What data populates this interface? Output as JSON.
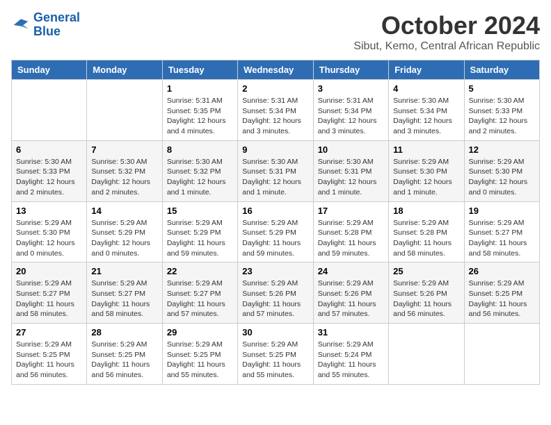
{
  "logo": {
    "line1": "General",
    "line2": "Blue"
  },
  "title": "October 2024",
  "subtitle": "Sibut, Kemo, Central African Republic",
  "weekdays": [
    "Sunday",
    "Monday",
    "Tuesday",
    "Wednesday",
    "Thursday",
    "Friday",
    "Saturday"
  ],
  "weeks": [
    [
      {
        "day": null,
        "detail": null
      },
      {
        "day": null,
        "detail": null
      },
      {
        "day": "1",
        "detail": "Sunrise: 5:31 AM\nSunset: 5:35 PM\nDaylight: 12 hours\nand 4 minutes."
      },
      {
        "day": "2",
        "detail": "Sunrise: 5:31 AM\nSunset: 5:34 PM\nDaylight: 12 hours\nand 3 minutes."
      },
      {
        "day": "3",
        "detail": "Sunrise: 5:31 AM\nSunset: 5:34 PM\nDaylight: 12 hours\nand 3 minutes."
      },
      {
        "day": "4",
        "detail": "Sunrise: 5:30 AM\nSunset: 5:34 PM\nDaylight: 12 hours\nand 3 minutes."
      },
      {
        "day": "5",
        "detail": "Sunrise: 5:30 AM\nSunset: 5:33 PM\nDaylight: 12 hours\nand 2 minutes."
      }
    ],
    [
      {
        "day": "6",
        "detail": "Sunrise: 5:30 AM\nSunset: 5:33 PM\nDaylight: 12 hours\nand 2 minutes."
      },
      {
        "day": "7",
        "detail": "Sunrise: 5:30 AM\nSunset: 5:32 PM\nDaylight: 12 hours\nand 2 minutes."
      },
      {
        "day": "8",
        "detail": "Sunrise: 5:30 AM\nSunset: 5:32 PM\nDaylight: 12 hours\nand 1 minute."
      },
      {
        "day": "9",
        "detail": "Sunrise: 5:30 AM\nSunset: 5:31 PM\nDaylight: 12 hours\nand 1 minute."
      },
      {
        "day": "10",
        "detail": "Sunrise: 5:30 AM\nSunset: 5:31 PM\nDaylight: 12 hours\nand 1 minute."
      },
      {
        "day": "11",
        "detail": "Sunrise: 5:29 AM\nSunset: 5:30 PM\nDaylight: 12 hours\nand 1 minute."
      },
      {
        "day": "12",
        "detail": "Sunrise: 5:29 AM\nSunset: 5:30 PM\nDaylight: 12 hours\nand 0 minutes."
      }
    ],
    [
      {
        "day": "13",
        "detail": "Sunrise: 5:29 AM\nSunset: 5:30 PM\nDaylight: 12 hours\nand 0 minutes."
      },
      {
        "day": "14",
        "detail": "Sunrise: 5:29 AM\nSunset: 5:29 PM\nDaylight: 12 hours\nand 0 minutes."
      },
      {
        "day": "15",
        "detail": "Sunrise: 5:29 AM\nSunset: 5:29 PM\nDaylight: 11 hours\nand 59 minutes."
      },
      {
        "day": "16",
        "detail": "Sunrise: 5:29 AM\nSunset: 5:29 PM\nDaylight: 11 hours\nand 59 minutes."
      },
      {
        "day": "17",
        "detail": "Sunrise: 5:29 AM\nSunset: 5:28 PM\nDaylight: 11 hours\nand 59 minutes."
      },
      {
        "day": "18",
        "detail": "Sunrise: 5:29 AM\nSunset: 5:28 PM\nDaylight: 11 hours\nand 58 minutes."
      },
      {
        "day": "19",
        "detail": "Sunrise: 5:29 AM\nSunset: 5:27 PM\nDaylight: 11 hours\nand 58 minutes."
      }
    ],
    [
      {
        "day": "20",
        "detail": "Sunrise: 5:29 AM\nSunset: 5:27 PM\nDaylight: 11 hours\nand 58 minutes."
      },
      {
        "day": "21",
        "detail": "Sunrise: 5:29 AM\nSunset: 5:27 PM\nDaylight: 11 hours\nand 58 minutes."
      },
      {
        "day": "22",
        "detail": "Sunrise: 5:29 AM\nSunset: 5:27 PM\nDaylight: 11 hours\nand 57 minutes."
      },
      {
        "day": "23",
        "detail": "Sunrise: 5:29 AM\nSunset: 5:26 PM\nDaylight: 11 hours\nand 57 minutes."
      },
      {
        "day": "24",
        "detail": "Sunrise: 5:29 AM\nSunset: 5:26 PM\nDaylight: 11 hours\nand 57 minutes."
      },
      {
        "day": "25",
        "detail": "Sunrise: 5:29 AM\nSunset: 5:26 PM\nDaylight: 11 hours\nand 56 minutes."
      },
      {
        "day": "26",
        "detail": "Sunrise: 5:29 AM\nSunset: 5:25 PM\nDaylight: 11 hours\nand 56 minutes."
      }
    ],
    [
      {
        "day": "27",
        "detail": "Sunrise: 5:29 AM\nSunset: 5:25 PM\nDaylight: 11 hours\nand 56 minutes."
      },
      {
        "day": "28",
        "detail": "Sunrise: 5:29 AM\nSunset: 5:25 PM\nDaylight: 11 hours\nand 56 minutes."
      },
      {
        "day": "29",
        "detail": "Sunrise: 5:29 AM\nSunset: 5:25 PM\nDaylight: 11 hours\nand 55 minutes."
      },
      {
        "day": "30",
        "detail": "Sunrise: 5:29 AM\nSunset: 5:25 PM\nDaylight: 11 hours\nand 55 minutes."
      },
      {
        "day": "31",
        "detail": "Sunrise: 5:29 AM\nSunset: 5:24 PM\nDaylight: 11 hours\nand 55 minutes."
      },
      {
        "day": null,
        "detail": null
      },
      {
        "day": null,
        "detail": null
      }
    ]
  ]
}
